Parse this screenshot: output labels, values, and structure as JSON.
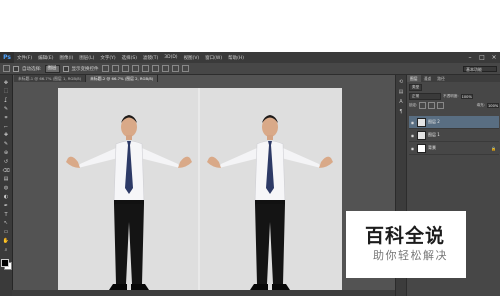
{
  "app": {
    "logo": "Ps"
  },
  "menubar": {
    "items": [
      "文件(F)",
      "编辑(E)",
      "图像(I)",
      "图层(L)",
      "文字(Y)",
      "选择(S)",
      "滤镜(T)",
      "3D(D)",
      "视图(V)",
      "窗口(W)",
      "帮助(H)"
    ],
    "window_controls": [
      "–",
      "□",
      "×"
    ]
  },
  "options_bar": {
    "auto_select_label": "自动选择:",
    "auto_select_value": "图层",
    "show_transform_label": "显示变换控件",
    "workspace": "基本功能"
  },
  "tabs": [
    {
      "label": "未标题-1 @ 66.7% (图层 1, RGB/8)",
      "active": false
    },
    {
      "label": "未标题-2 @ 66.7% (图层 2, RGB/8)",
      "active": true
    }
  ],
  "tools": [
    "move-tool",
    "marquee-tool",
    "lasso-tool",
    "quick-select-tool",
    "crop-tool",
    "eyedropper-tool",
    "healing-tool",
    "brush-tool",
    "clone-tool",
    "history-brush-tool",
    "eraser-tool",
    "gradient-tool",
    "blur-tool",
    "dodge-tool",
    "pen-tool",
    "type-tool",
    "path-select-tool",
    "shape-tool",
    "hand-tool",
    "zoom-tool"
  ],
  "tool_glyphs": [
    "✥",
    "⬚",
    "ʆ",
    "✎",
    "⌗",
    "⌐",
    "✚",
    "✎",
    "⊕",
    "↺",
    "⌫",
    "▤",
    "◍",
    "◐",
    "✒",
    "T",
    "↖",
    "▭",
    "✋",
    "⌕"
  ],
  "layers_panel": {
    "tabs": [
      "图层",
      "通道",
      "路径"
    ],
    "kind_label": "类型",
    "blend_mode": "正常",
    "opacity_label": "不透明度:",
    "opacity_value": "100%",
    "lock_label": "锁定:",
    "fill_label": "填充:",
    "fill_value": "100%",
    "layers": [
      {
        "name": "图层 2",
        "selected": true,
        "thumb": "photo"
      },
      {
        "name": "图层 1",
        "selected": false,
        "thumb": "photo"
      },
      {
        "name": "背景",
        "selected": false,
        "thumb": "white",
        "locked": true
      }
    ],
    "lock_glyph": "🔒"
  },
  "watermark": {
    "title": "百科全说",
    "subtitle": "助你轻松解决"
  }
}
